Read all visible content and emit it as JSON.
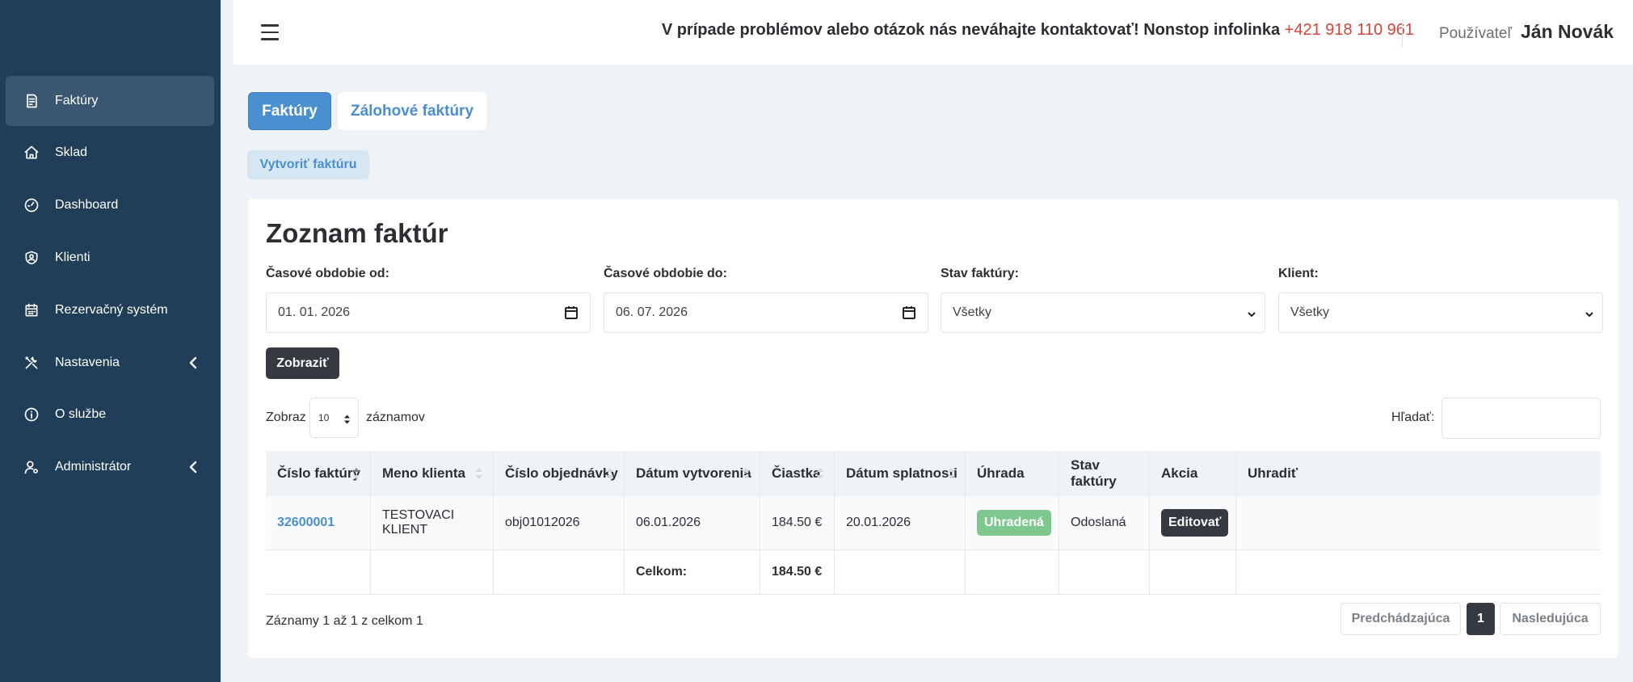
{
  "sidebar": {
    "items": [
      {
        "label": "Faktúry",
        "icon": "invoice-icon",
        "active": true
      },
      {
        "label": "Sklad",
        "icon": "home-icon"
      },
      {
        "label": "Dashboard",
        "icon": "gauge-icon"
      },
      {
        "label": "Klienti",
        "icon": "shield-user-icon"
      },
      {
        "label": "Rezervačný systém",
        "icon": "calendar-icon"
      },
      {
        "label": "Nastavenia",
        "icon": "tools-icon",
        "submenu": true
      },
      {
        "label": "O službe",
        "icon": "info-icon"
      },
      {
        "label": "Administrátor",
        "icon": "user-gear-icon",
        "submenu": true
      }
    ]
  },
  "header": {
    "info_text": "V prípade problémov alebo otázok nás neváhajte kontaktovať! Nonstop infolinka",
    "phone": "+421 918 110 961",
    "user_label": "Používateľ",
    "user_name": "Ján Novák"
  },
  "tabs": [
    {
      "label": "Faktúry",
      "active": true
    },
    {
      "label": "Zálohové faktúry",
      "active": false
    }
  ],
  "create_button": "Vytvoriť faktúru",
  "card": {
    "title": "Zoznam faktúr",
    "filters": {
      "from_label": "Časové obdobie od:",
      "from_value": "01. 01. 2026",
      "to_label": "Časové obdobie do:",
      "to_value": "06. 07. 2026",
      "status_label": "Stav faktúry:",
      "status_value": "Všetky",
      "client_label": "Klient:",
      "client_value": "Všetky",
      "show_button": "Zobraziť"
    },
    "length": {
      "prefix": "Zobraz",
      "value": "10",
      "suffix": "záznamov"
    },
    "search_label": "Hľadať:",
    "table": {
      "headers": [
        "Číslo faktúry",
        "Meno klienta",
        "Číslo objednávky",
        "Dátum vytvorenia",
        "Čiastka",
        "Dátum splatnosti",
        "Úhrada",
        "Stav faktúry",
        "Akcia",
        "Uhradiť"
      ],
      "rows": [
        {
          "number": "32600001",
          "client": "TESTOVACI KLIENT",
          "order": "obj01012026",
          "created": "06.01.2026",
          "amount": "184.50 €",
          "due": "20.01.2026",
          "payment": "Uhradená",
          "status": "Odoslaná",
          "action": "Editovať",
          "pay": ""
        }
      ],
      "total_label": "Celkom:",
      "total_amount": "184.50 €"
    },
    "info": "Záznamy 1 až 1 z celkom 1",
    "pagination": {
      "prev": "Predchádzajúca",
      "current": "1",
      "next": "Nasledujúca"
    }
  },
  "colors": {
    "sidebar": "#213e58",
    "accent": "#4a8fd0",
    "phone": "#d1453b",
    "badge": "#7ec78f",
    "dark": "#343a40"
  }
}
